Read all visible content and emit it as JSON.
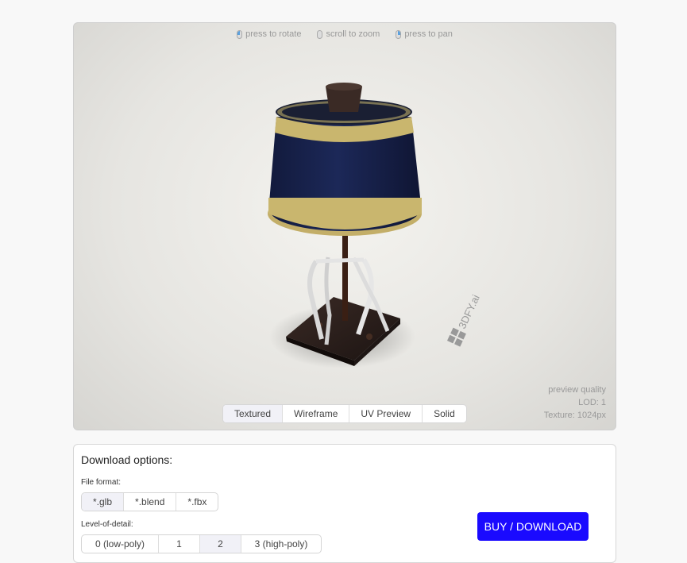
{
  "viewer": {
    "hints": [
      {
        "icon": "mouse-left-icon",
        "text": "press to rotate"
      },
      {
        "icon": "mouse-scroll-icon",
        "text": "scroll to zoom"
      },
      {
        "icon": "mouse-right-icon",
        "text": "press to pan"
      }
    ],
    "watermark": "3DFY.ai",
    "quality": {
      "line1": "preview quality",
      "line2": "LOD: 1",
      "line3": "Texture: 1024px"
    },
    "modes": [
      "Textured",
      "Wireframe",
      "UV Preview",
      "Solid"
    ],
    "active_mode": "Textured"
  },
  "download": {
    "title": "Download options:",
    "file_format_label": "File format:",
    "formats": [
      "*.glb",
      "*.blend",
      "*.fbx"
    ],
    "active_format": "*.glb",
    "lod_label": "Level-of-detail:",
    "lods": [
      "0 (low-poly)",
      "1",
      "2",
      "3 (high-poly)"
    ],
    "active_lod": "2",
    "buy_label": "BUY / DOWNLOAD"
  },
  "colors": {
    "accent": "#1a0aff",
    "shade": "#17214a",
    "trim": "#c9b66e"
  }
}
